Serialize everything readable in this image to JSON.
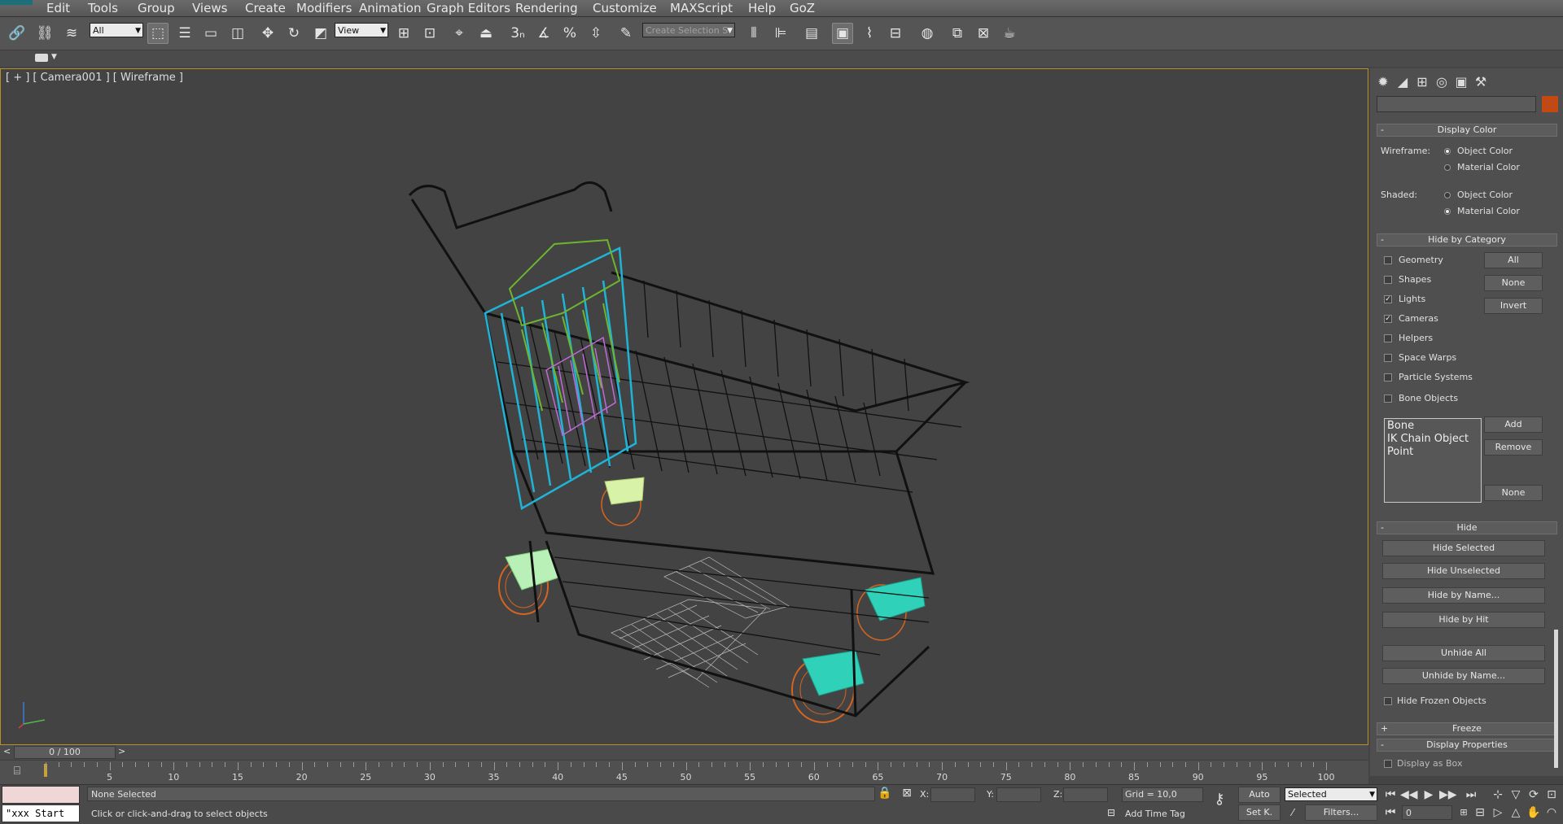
{
  "menu": [
    "Edit",
    "Tools",
    "Group",
    "Views",
    "Create",
    "Modifiers",
    "Animation",
    "Graph Editors",
    "Rendering",
    "Customize",
    "MAXScript",
    "Help",
    "GoZ"
  ],
  "toolbar": {
    "filter_value": "All",
    "ref_coord_value": "View",
    "selection_set_placeholder": "Create Selection S",
    "snap_label": "3"
  },
  "viewport": {
    "label": "[ + ] [ Camera001 ] [ Wireframe ]"
  },
  "cmdpanel": {
    "name_field": "",
    "swatch_color": "#c24a12",
    "display_color": {
      "title": "Display Color",
      "wireframe_label": "Wireframe:",
      "shaded_label": "Shaded:",
      "object_color": "Object Color",
      "material_color": "Material Color"
    },
    "hide_by_category": {
      "title": "Hide by Category",
      "items": [
        {
          "label": "Geometry",
          "checked": false
        },
        {
          "label": "Shapes",
          "checked": false
        },
        {
          "label": "Lights",
          "checked": true
        },
        {
          "label": "Cameras",
          "checked": true
        },
        {
          "label": "Helpers",
          "checked": false
        },
        {
          "label": "Space Warps",
          "checked": false
        },
        {
          "label": "Particle Systems",
          "checked": false
        },
        {
          "label": "Bone Objects",
          "checked": false
        }
      ],
      "btn_all": "All",
      "btn_none": "None",
      "btn_invert": "Invert",
      "list": [
        "Bone",
        "IK Chain Object",
        "Point"
      ],
      "btn_add": "Add",
      "btn_remove": "Remove",
      "btn_none2": "None"
    },
    "hide": {
      "title": "Hide",
      "buttons": [
        "Hide Selected",
        "Hide Unselected",
        "Hide by Name...",
        "Hide by Hit",
        "Unhide All",
        "Unhide by Name..."
      ],
      "hide_frozen": "Hide Frozen Objects"
    },
    "freeze": {
      "title": "Freeze"
    },
    "display_properties": {
      "title": "Display Properties",
      "display_as_box": "Display as Box"
    }
  },
  "timeline": {
    "frame_counter": "0 / 100",
    "ticks": [
      "5",
      "10",
      "15",
      "20",
      "25",
      "30",
      "35",
      "40",
      "45",
      "50",
      "55",
      "60",
      "65",
      "70",
      "75",
      "80",
      "85",
      "90",
      "95",
      "100"
    ]
  },
  "status": {
    "maxscript_text": "\"xxx Start",
    "selection_status": "None Selected",
    "prompt": "Click or click-and-drag to select objects",
    "x_label": "X:",
    "y_label": "Y:",
    "z_label": "Z:",
    "grid": "Grid = 10,0",
    "add_time_tag": "Add Time Tag",
    "auto": "Auto",
    "set_key": "Set K.",
    "key_mode": "Selected",
    "filters": "Filters...",
    "current_frame": "0"
  }
}
